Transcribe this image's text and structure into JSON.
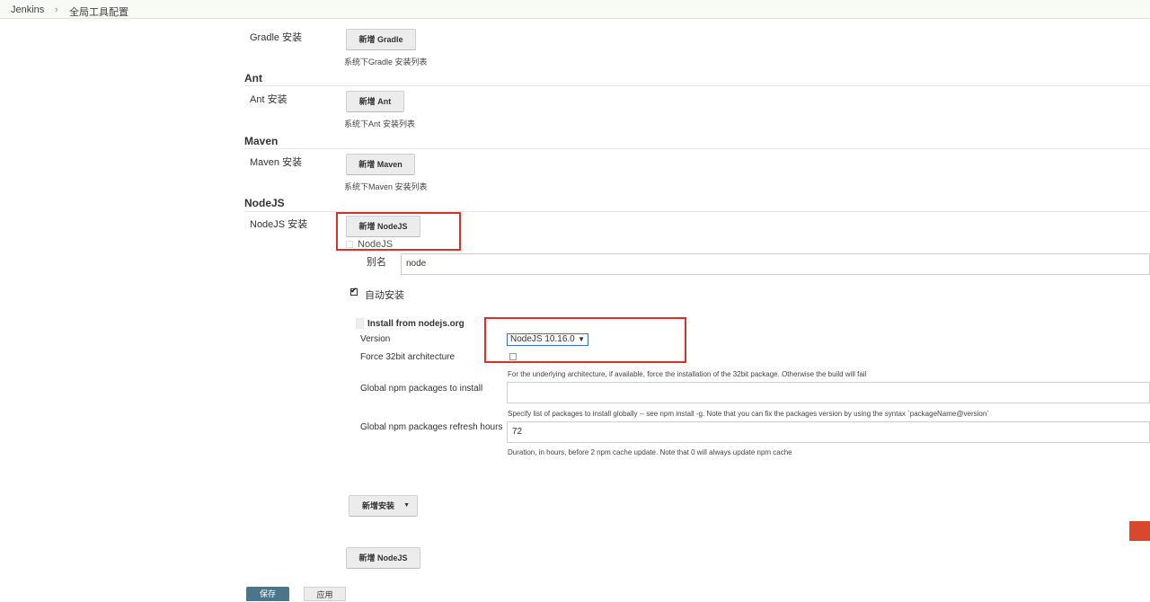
{
  "breadcrumb": {
    "root": "Jenkins",
    "separator": "›",
    "current": "全局工具配置"
  },
  "gradle": {
    "row_label": "Gradle 安装",
    "add_button": "新增 Gradle",
    "hint": "系统下Gradle 安装列表"
  },
  "ant": {
    "section_title": "Ant",
    "row_label": "Ant 安装",
    "add_button": "新增 Ant",
    "hint": "系统下Ant 安装列表"
  },
  "maven": {
    "section_title": "Maven",
    "row_label": "Maven 安装",
    "add_button": "新增 Maven",
    "hint": "系统下Maven 安装列表"
  },
  "nodejs": {
    "section_title": "NodeJS",
    "row_label": "NodeJS 安装",
    "add_button": "新增 NodeJS",
    "installation_header": "NodeJS",
    "alias_label": "别名",
    "alias_value": "node",
    "auto_install_label": "自动安装",
    "installer": {
      "title": "Install from nodejs.org",
      "version_label": "Version",
      "version_value": "NodeJS 10.16.0",
      "force32_label": "Force 32bit architecture",
      "force32_hint": "For the underlying architecture, if available, force the installation of the 32bit package. Otherwise the build will fail",
      "global_pkgs_label": "Global npm packages to install",
      "global_pkgs_value": "",
      "global_pkgs_hint": "Specify list of packages to install globally -- see npm install -g. Note that you can fix the packages version by using the syntax `packageName@version`",
      "refresh_label": "Global npm packages refresh hours",
      "refresh_value": "72",
      "refresh_hint": "Duration, in hours, before 2 npm cache update. Note that 0 will always update npm cache"
    },
    "add_installer_button": "新增安装",
    "add_button_bottom": "新增 NodeJS"
  },
  "footer": {
    "save_button": "保存",
    "apply_button": "应用"
  },
  "colors": {
    "highlight": "#d9302a",
    "save_button": "#4b758b"
  }
}
